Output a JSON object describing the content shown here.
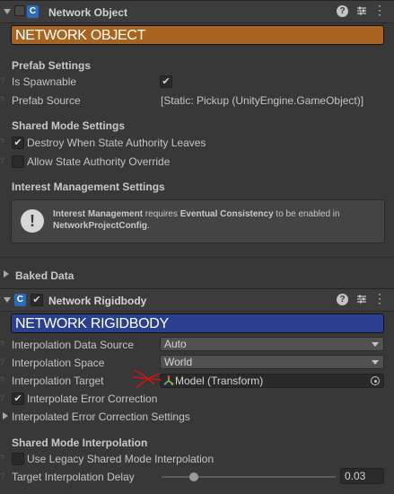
{
  "network_object": {
    "title": "Network Object",
    "banner": "NETWORK OBJECT",
    "banner_color": "#a8641e",
    "prefab_section": "Prefab Settings",
    "is_spawnable_label": "Is Spawnable",
    "is_spawnable": true,
    "prefab_source_label": "Prefab Source",
    "prefab_source_value": "[Static: Pickup (UnityEngine.GameObject)]",
    "shared_mode_section": "Shared Mode Settings",
    "destroy_label": "Destroy When State Authority Leaves",
    "destroy_checked": true,
    "allow_override_label": "Allow State Authority Override",
    "allow_override_checked": false,
    "interest_section": "Interest Management Settings",
    "info_part1": "Interest Management",
    "info_part2": " requires ",
    "info_part3": "Eventual Consistency",
    "info_part4": " to be enabled in",
    "info_part5": "NetworkProjectConfig",
    "info_part6": "."
  },
  "baked_data": {
    "label": "Baked Data"
  },
  "network_rigidbody": {
    "title": "Network Rigidbody",
    "enabled": true,
    "banner": "NETWORK RIGIDBODY",
    "banner_color": "#2a3f8f",
    "interp_source_label": "Interpolation Data Source",
    "interp_source_value": "Auto",
    "interp_space_label": "Interpolation Space",
    "interp_space_value": "World",
    "interp_target_label": "Interpolation Target",
    "interp_target_value": "Model (Transform)",
    "interp_error_label": "Interpolate Error Correction",
    "interp_error_checked": true,
    "error_settings_label": "Interpolated Error Correction Settings",
    "shared_interp_section": "Shared Mode Interpolation",
    "legacy_label": "Use Legacy Shared Mode Interpolation",
    "legacy_checked": false,
    "delay_label": "Target Interpolation Delay",
    "delay_value": "0.03",
    "delay_fraction": 0.06
  },
  "icons": [
    "help-icon",
    "preset-icon",
    "menu-icon",
    "script-icon",
    "info-icon",
    "target-icon",
    "transform-icon"
  ],
  "annotation_color": "#e01010"
}
